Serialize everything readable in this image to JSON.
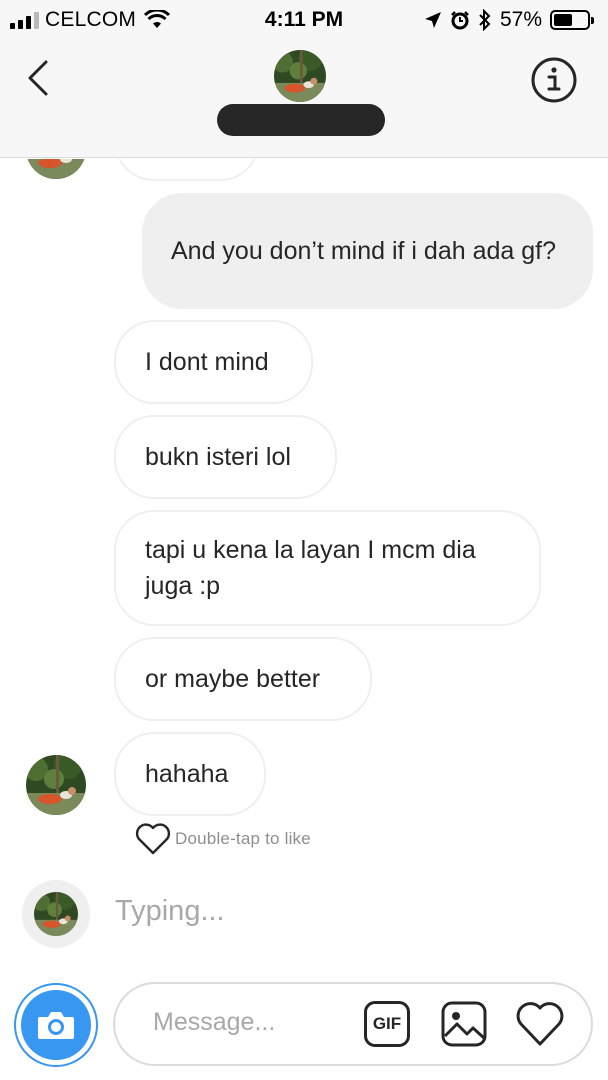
{
  "status_bar": {
    "carrier": "CELCOM",
    "time": "4:11 PM",
    "battery_percent": "57%",
    "battery_level": 0.57,
    "icons": [
      "signal-icon",
      "wifi-icon",
      "location-arrow-icon",
      "alarm-icon",
      "bluetooth-icon",
      "battery-icon"
    ]
  },
  "header": {
    "icons": [
      "back-chevron-icon",
      "info-icon"
    ]
  },
  "messages": [
    {
      "direction": "outgoing",
      "text": "And you don’t mind if i dah ada gf?"
    },
    {
      "direction": "incoming",
      "text": "I dont mind"
    },
    {
      "direction": "incoming",
      "text": "bukn isteri lol"
    },
    {
      "direction": "incoming",
      "text": "tapi u kena la layan I mcm dia juga :p"
    },
    {
      "direction": "incoming",
      "text": "or maybe better"
    },
    {
      "direction": "incoming",
      "text": "hahaha"
    }
  ],
  "like_hint": "Double-tap to like",
  "typing_indicator": "Typing...",
  "composer": {
    "placeholder": "Message...",
    "gif_label": "GIF",
    "icons": [
      "camera-icon",
      "gif-icon",
      "gallery-icon",
      "heart-icon"
    ]
  },
  "colors": {
    "accent_blue": "#3897f0",
    "outgoing_bubble": "#efefef",
    "incoming_border": "#efefef",
    "text": "#262626",
    "muted": "#8e8e8e"
  }
}
